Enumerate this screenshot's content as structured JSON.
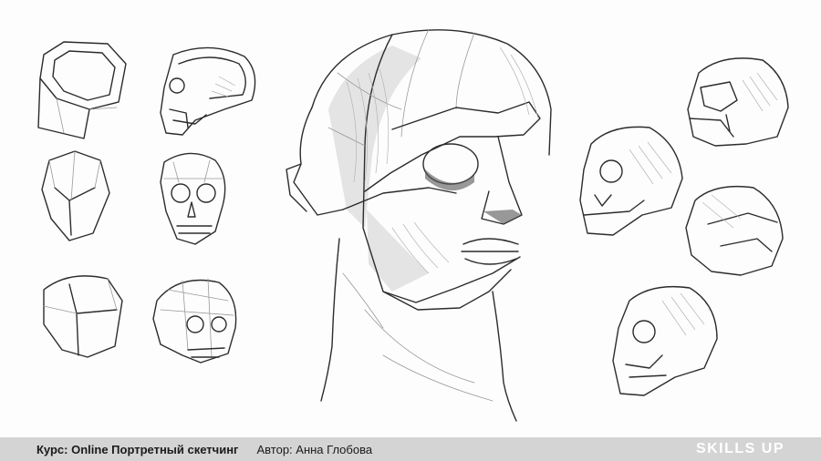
{
  "footer": {
    "course": "Курс: Online Портретный скетчинг",
    "author": "Автор: Анна Глобова",
    "brand": "SKILLS UP"
  },
  "colors": {
    "footer_bg": "#d4d4d4",
    "brand_text": "#ffffff",
    "sketch_line": "#2c2c2c"
  }
}
